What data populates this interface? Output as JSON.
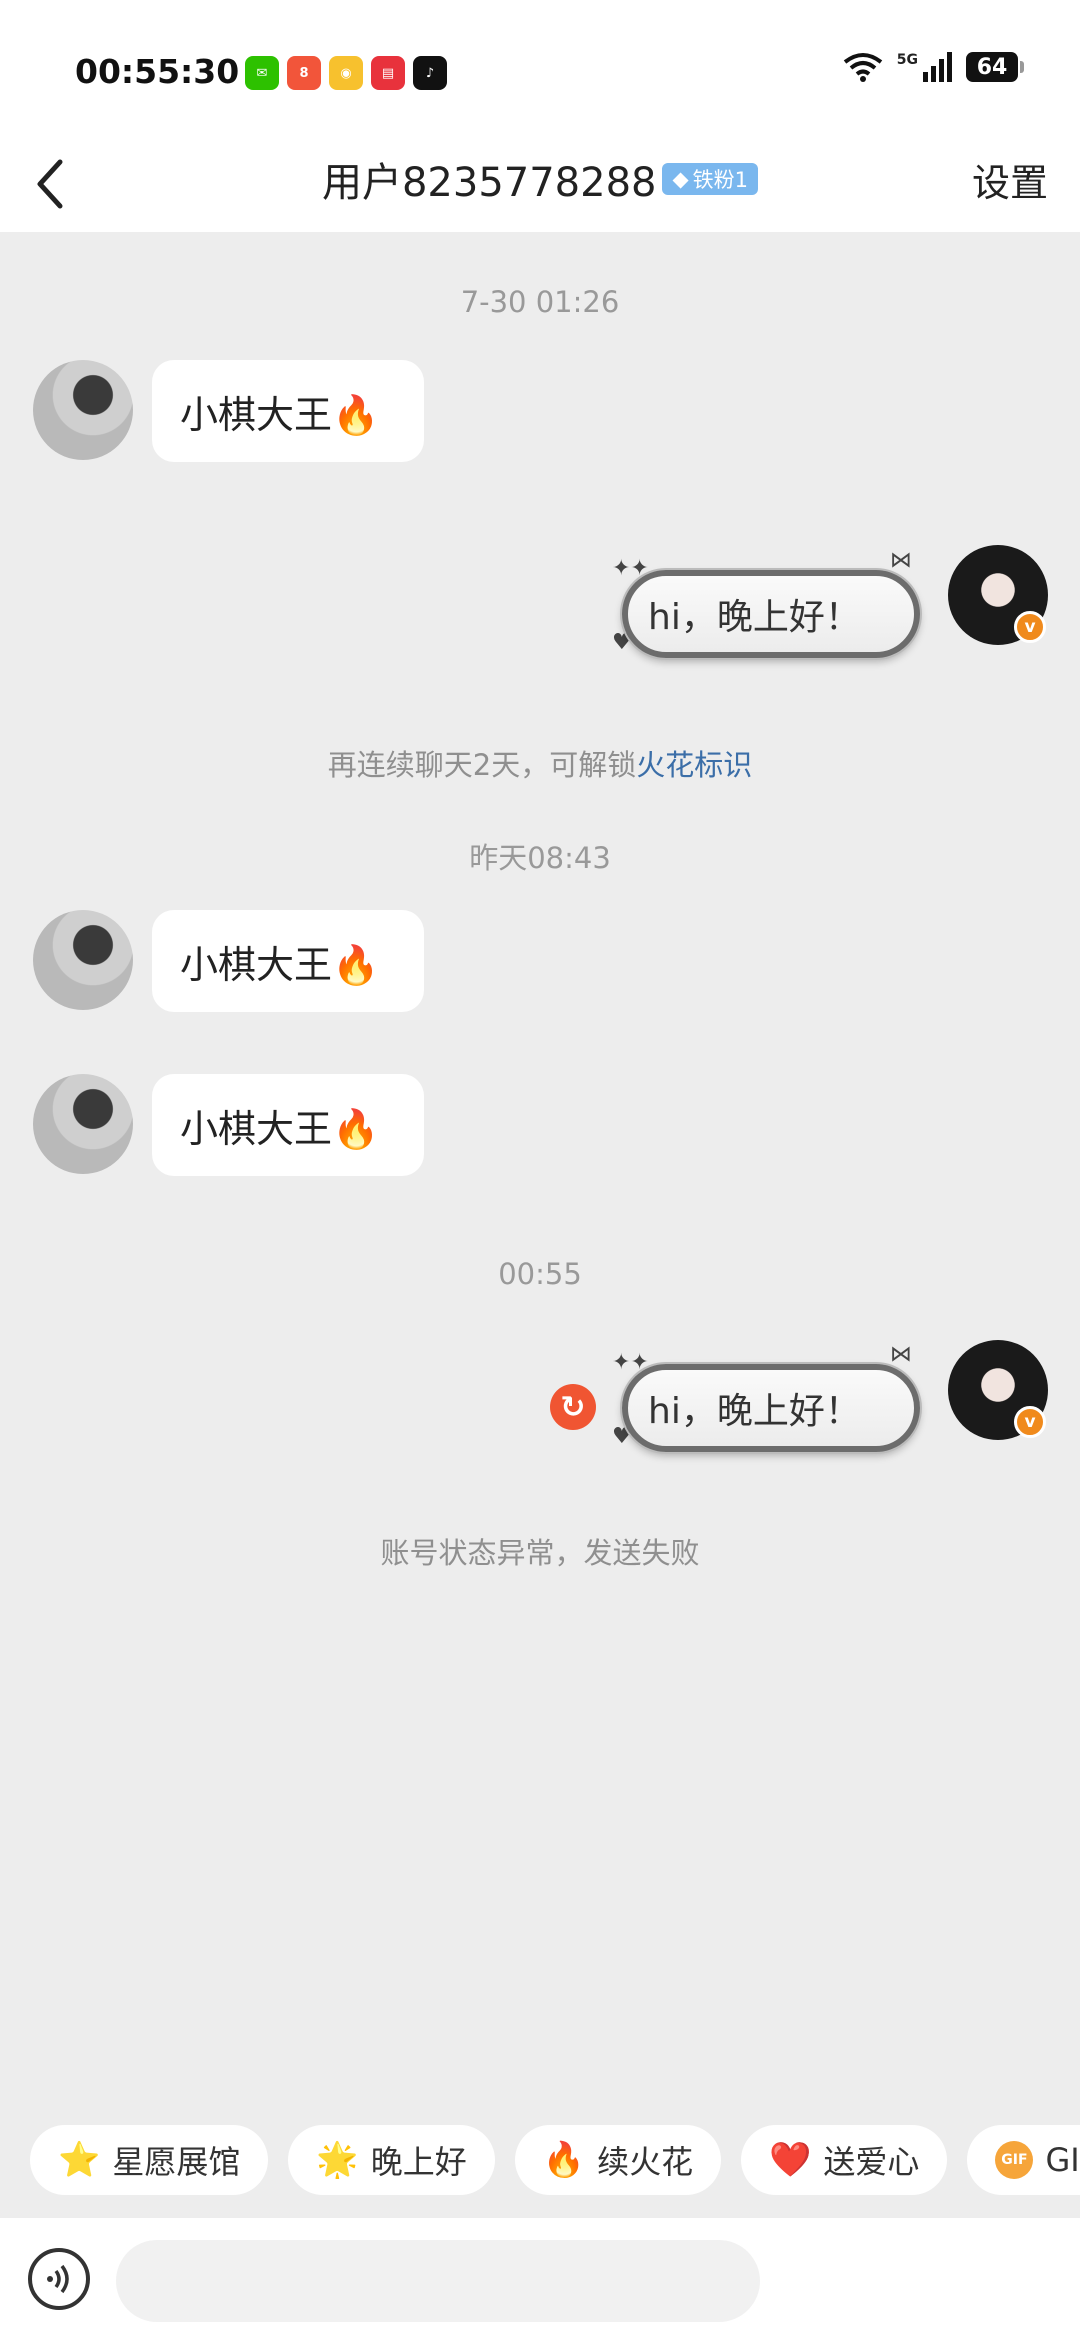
{
  "status_bar": {
    "time": "00:55:30",
    "network": "5G",
    "battery": "64",
    "apps": [
      "wechat-icon",
      "app-icon",
      "weibo-icon",
      "app-icon",
      "tiktok-icon"
    ]
  },
  "nav": {
    "title": "用户8235778288",
    "badge": "铁粉1",
    "settings": "设置"
  },
  "chat": {
    "timestamp_1": "7-30 01:26",
    "msg_1": "小棋大王🔥",
    "msg_2": "hi，晚上好！",
    "note_prefix": "再连续聊天2天，可解锁",
    "note_link": "火花标识",
    "timestamp_2": "昨天08:43",
    "msg_3": "小棋大王🔥",
    "msg_4": "小棋大王🔥",
    "timestamp_3": "00:55",
    "msg_5": "hi，晚上好！",
    "error_note": "账号状态异常，发送失败"
  },
  "chips": [
    {
      "icon": "⭐",
      "label": "星愿展馆"
    },
    {
      "icon": "🌟",
      "label": "晚上好"
    },
    {
      "icon": "🔥",
      "label": "续火花"
    },
    {
      "icon": "❤️",
      "label": "送爱心"
    },
    {
      "icon": "GIF",
      "label": "GIF"
    }
  ],
  "colors": {
    "accent_link": "#3b6ea8",
    "retry": "#f05532",
    "badge": "#7ab7ee",
    "verified": "#f08a1c"
  }
}
